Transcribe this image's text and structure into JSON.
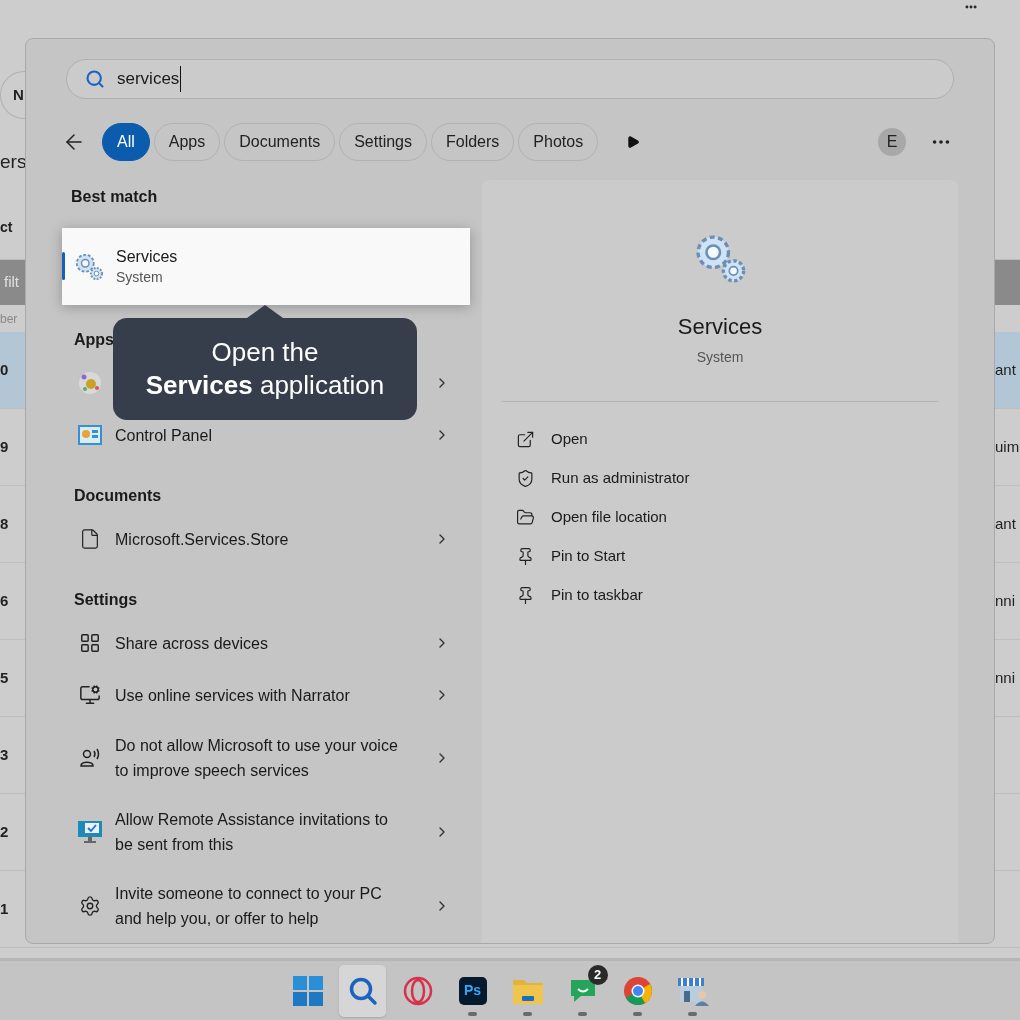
{
  "background_app": {
    "top_button": "N",
    "heading": "ers",
    "column_label": "ct",
    "filter_bar": "filt",
    "header": "ber",
    "rows": [
      {
        "number": "0",
        "status": "ant",
        "selected": true
      },
      {
        "number": "9",
        "status": "uim",
        "selected": false
      },
      {
        "number": "8",
        "status": "ant",
        "selected": false
      },
      {
        "number": "6",
        "status": "nni",
        "selected": false
      },
      {
        "number": "5",
        "status": "nni",
        "selected": false
      },
      {
        "number": "3",
        "selected": false
      },
      {
        "number": "2",
        "selected": false
      },
      {
        "number": "1",
        "selected": false
      }
    ]
  },
  "search": {
    "value": "services"
  },
  "filters": [
    {
      "label": "All",
      "selected": true
    },
    {
      "label": "Apps",
      "selected": false
    },
    {
      "label": "Documents",
      "selected": false
    },
    {
      "label": "Settings",
      "selected": false
    },
    {
      "label": "Folders",
      "selected": false
    },
    {
      "label": "Photos",
      "selected": false
    }
  ],
  "account_initial": "E",
  "sections": [
    {
      "heading": "Best match",
      "items": [
        {
          "kind": "best",
          "title": "Services",
          "subtitle": "System",
          "selected": true
        }
      ]
    },
    {
      "heading": "Apps",
      "items": [
        {
          "kind": "app"
        },
        {
          "kind": "app",
          "title": "Control Panel"
        }
      ]
    },
    {
      "heading": "Documents",
      "items": [
        {
          "kind": "document",
          "title": "Microsoft.Services.Store"
        }
      ]
    },
    {
      "heading": "Settings",
      "items": [
        {
          "kind": "share",
          "title": "Share across devices"
        },
        {
          "kind": "narrator",
          "title": "Use online services with Narrator"
        },
        {
          "kind": "voice",
          "title": "Do not allow Microsoft to use your voice to improve speech services"
        },
        {
          "kind": "remote",
          "title": "Allow Remote Assistance invitations to be sent from this"
        },
        {
          "kind": "gear",
          "title": "Invite someone to connect to your PC and help you, or offer to help"
        }
      ]
    }
  ],
  "tooltip": {
    "lines": [
      "Open the",
      "**Services** application"
    ]
  },
  "preview": {
    "title": "Services",
    "subtitle": "System",
    "actions": [
      {
        "kind": "open",
        "label": "Open"
      },
      {
        "kind": "admin",
        "label": "Run as administrator"
      },
      {
        "kind": "folder",
        "label": "Open file location"
      },
      {
        "kind": "pin",
        "label": "Pin to Start"
      },
      {
        "kind": "pin",
        "label": "Pin to taskbar"
      }
    ]
  },
  "taskbar": [
    {
      "kind": "start",
      "running": false,
      "selected": false
    },
    {
      "kind": "search",
      "running": false,
      "selected": true
    },
    {
      "kind": "opera",
      "running": false,
      "selected": false
    },
    {
      "kind": "photoshop",
      "label": "Ps",
      "running": true,
      "selected": false
    },
    {
      "kind": "files",
      "running": true,
      "selected": false
    },
    {
      "kind": "chat",
      "badge": "2",
      "running": true,
      "selected": false
    },
    {
      "kind": "chrome",
      "running": true,
      "selected": false
    },
    {
      "kind": "store",
      "running": true,
      "selected": false
    }
  ]
}
